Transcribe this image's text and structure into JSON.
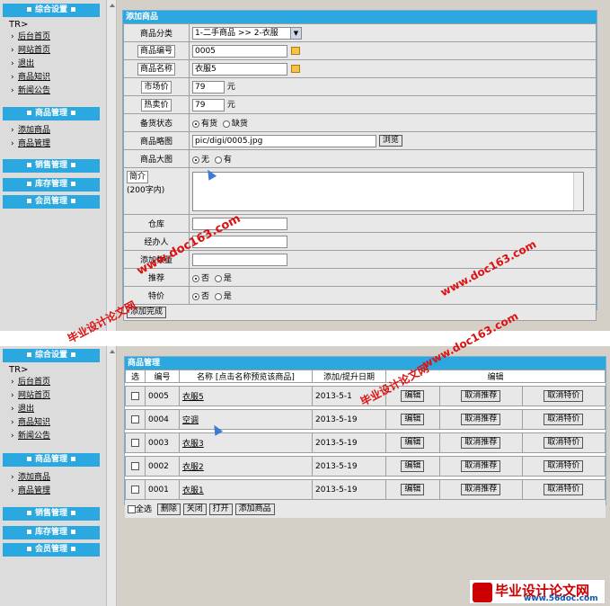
{
  "sidebar": {
    "sections": {
      "general": "综合设置",
      "product": "商品管理",
      "sales": "销售管理",
      "stock": "库存管理",
      "member": "会员管理"
    },
    "tr_label": "TR>",
    "general_items": [
      "后台首页",
      "网站首页",
      "退出",
      "商品知识",
      "新闻公告"
    ],
    "product_items": [
      "添加商品",
      "商品管理"
    ]
  },
  "add_form": {
    "title": "添加商品",
    "category_label": "商品分类",
    "category_value": "1-二手商品 >> 2-衣服",
    "code_label": "商品编号",
    "code_value": "0005",
    "name_label": "商品名称",
    "name_value": "衣服5",
    "market_price_label": "市场价",
    "market_price_value": "79",
    "hot_price_label": "热卖价",
    "hot_price_value": "79",
    "price_unit": "元",
    "stock_status_label": "备货状态",
    "stock_status_options": [
      "有货",
      "缺货"
    ],
    "thumb_label": "商品略图",
    "thumb_value": "pic/digi/0005.jpg",
    "browse_label": "浏览",
    "big_image_label": "商品大图",
    "big_image_options": [
      "无",
      "有"
    ],
    "intro_label": "简介",
    "intro_limit": "(200字内)",
    "warehouse_label": "仓库",
    "operator_label": "经办人",
    "add_qty_label": "添加数量",
    "recommend_label": "推荐",
    "special_label": "特价",
    "yes_no": [
      "否",
      "是"
    ],
    "submit_label": "添加完成"
  },
  "manage": {
    "title": "商品管理",
    "columns": [
      "选",
      "编号",
      "名称 [点击名称预览该商品]",
      "添加/提升日期",
      "编辑"
    ],
    "rows": [
      {
        "code": "0005",
        "name": "衣服5",
        "date": "2013-5-1"
      },
      {
        "code": "0004",
        "name": "空调",
        "date": "2013-5-19"
      },
      {
        "code": "0003",
        "name": "衣服3",
        "date": "2013-5-19"
      },
      {
        "code": "0002",
        "name": "衣服2",
        "date": "2013-5-19"
      },
      {
        "code": "0001",
        "name": "衣服1",
        "date": "2013-5-19"
      }
    ],
    "edit_label": "编辑",
    "cancel_recommend_label": "取消推荐",
    "cancel_special_label": "取消特价",
    "select_all_label": "全选",
    "footer_buttons": [
      "删除",
      "关闭",
      "打开",
      "添加商品"
    ]
  },
  "watermarks": {
    "site": "www.doc163.com",
    "brand": "毕业设计论文网"
  },
  "logo": {
    "name": "毕业设计论文网",
    "url": "www.56doc.com"
  },
  "colors": {
    "header_blue": "#2aa8df",
    "panel_gray": "#d4d0c8",
    "watermark_red": "#dd1111"
  }
}
